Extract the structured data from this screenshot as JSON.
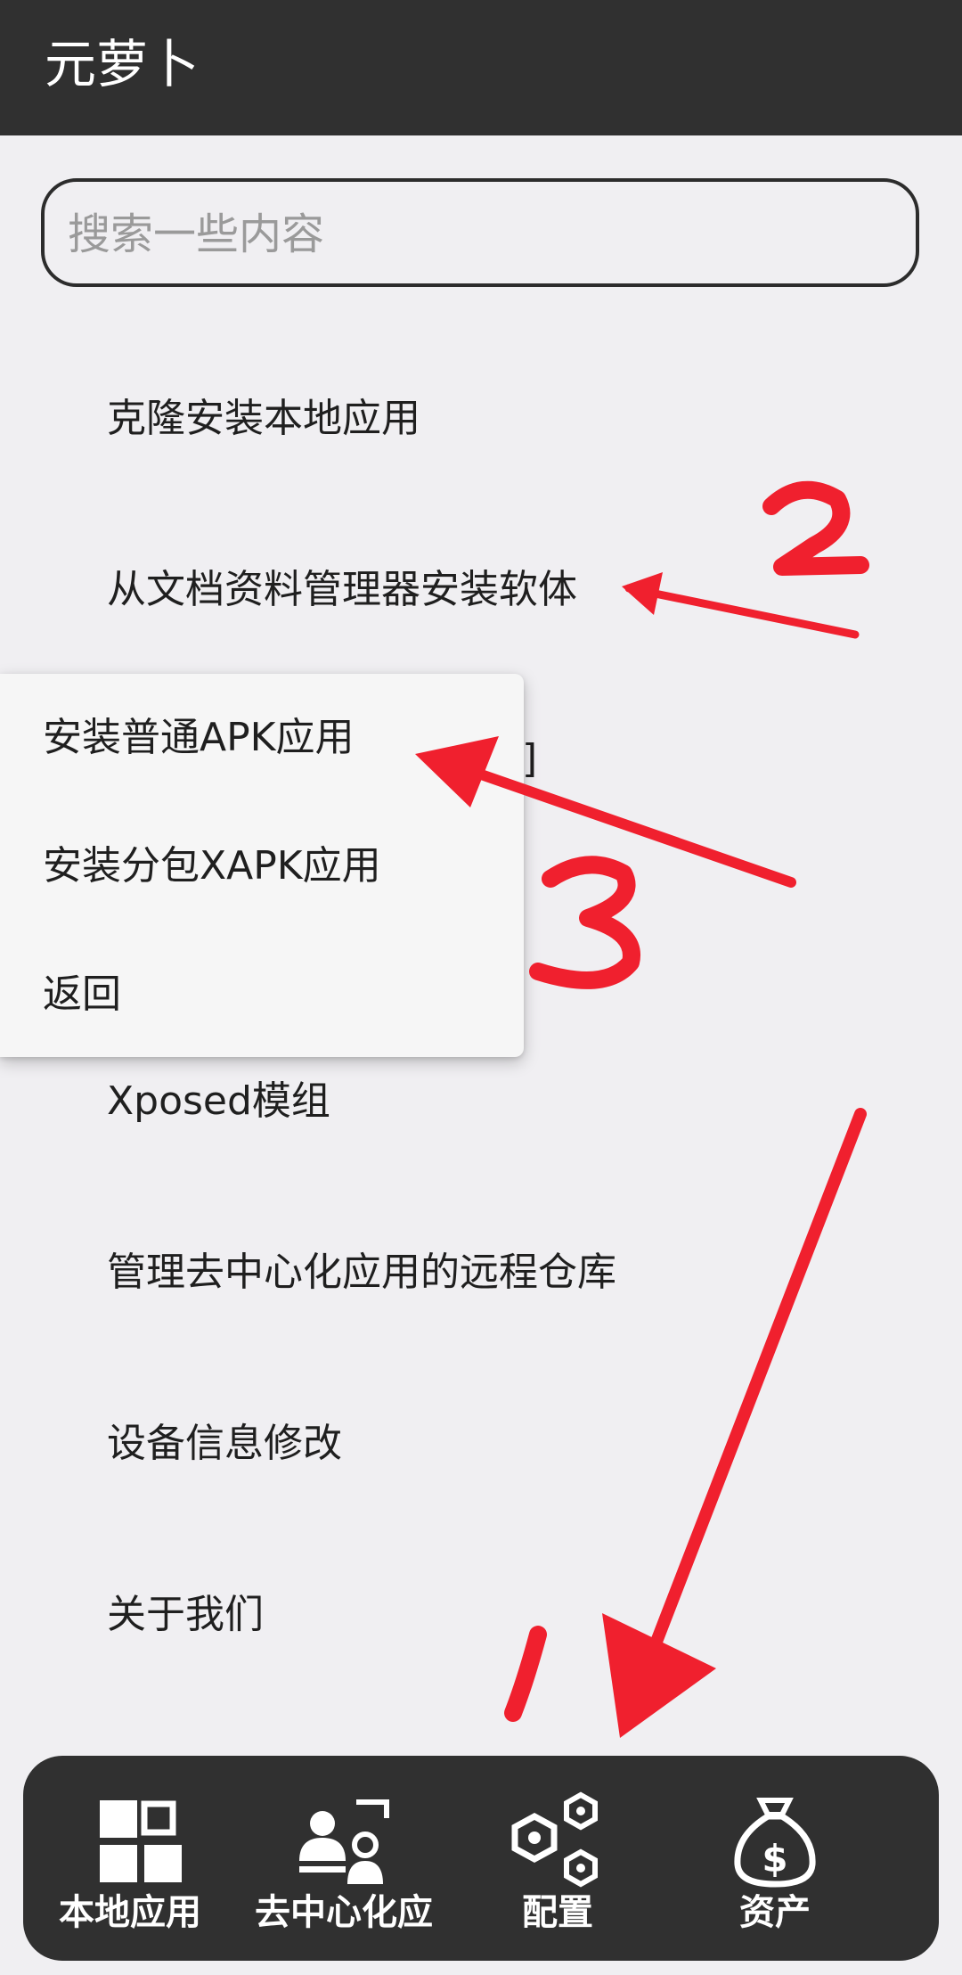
{
  "app": {
    "title": "元萝卜"
  },
  "search": {
    "placeholder": "搜索一些内容"
  },
  "menu": {
    "items": [
      {
        "label": "克隆安装本地应用"
      },
      {
        "label": "从文档资料管理器安装软体"
      },
      {
        "label": "Xposed模组"
      },
      {
        "label": "管理去中心化应用的远程仓库"
      },
      {
        "label": "设备信息修改"
      },
      {
        "label": "关于我们"
      }
    ],
    "hidden_fragment": "]"
  },
  "popup": {
    "items": [
      {
        "label": "安装普通APK应用"
      },
      {
        "label": "安装分包XAPK应用"
      },
      {
        "label": "返回"
      }
    ]
  },
  "bottom_nav": {
    "tabs": [
      {
        "label": "本地应用",
        "icon": "grid-icon"
      },
      {
        "label": "去中心化应",
        "icon": "people-icon"
      },
      {
        "label": "配置",
        "icon": "hexagon-nodes-icon",
        "selected": true
      },
      {
        "label": "资产",
        "icon": "money-bag-icon"
      }
    ]
  },
  "annotations": {
    "color": "#f0202e",
    "labels": [
      "1",
      "2",
      "3"
    ]
  },
  "colors": {
    "topbar": "#303030",
    "background": "#f0eff2",
    "bottom_nav": "#303030",
    "annotation": "#f0202e"
  }
}
